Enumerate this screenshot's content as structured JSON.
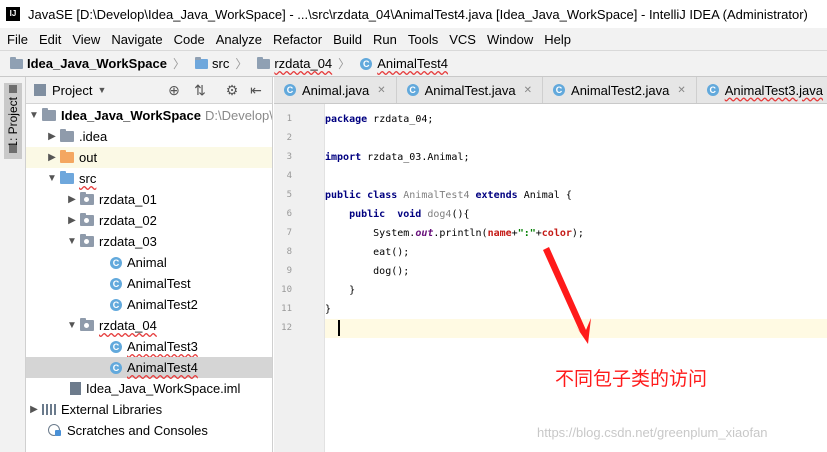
{
  "window": {
    "title": "JavaSE [D:\\Develop\\Idea_Java_WorkSpace] - ...\\src\\rzdata_04\\AnimalTest4.java [Idea_Java_WorkSpace] - IntelliJ IDEA (Administrator)",
    "app_icon_text": "IJ"
  },
  "menu": [
    "File",
    "Edit",
    "View",
    "Navigate",
    "Code",
    "Analyze",
    "Refactor",
    "Build",
    "Run",
    "Tools",
    "VCS",
    "Window",
    "Help"
  ],
  "breadcrumb": {
    "project": "Idea_Java_WorkSpace",
    "src": "src",
    "package": "rzdata_04",
    "file": "AnimalTest4"
  },
  "tool_strip": {
    "project_tab": "1: Project"
  },
  "project_panel": {
    "header_label": "Project",
    "tree": [
      {
        "label": "Idea_Java_WorkSpace",
        "hint": "D:\\Develop\\"
      },
      {
        "label": ".idea"
      },
      {
        "label": "out"
      },
      {
        "label": "src"
      },
      {
        "label": "rzdata_01"
      },
      {
        "label": "rzdata_02"
      },
      {
        "label": "rzdata_03"
      },
      {
        "label": "Animal"
      },
      {
        "label": "AnimalTest"
      },
      {
        "label": "AnimalTest2"
      },
      {
        "label": "rzdata_04"
      },
      {
        "label": "AnimalTest3"
      },
      {
        "label": "AnimalTest4"
      },
      {
        "label": "Idea_Java_WorkSpace.iml"
      },
      {
        "label": "External Libraries"
      },
      {
        "label": "Scratches and Consoles"
      }
    ]
  },
  "editor_tabs": [
    "Animal.java",
    "AnimalTest.java",
    "AnimalTest2.java",
    "AnimalTest3.java"
  ],
  "code": {
    "line_numbers": [
      "1",
      "2",
      "3",
      "4",
      "5",
      "6",
      "7",
      "8",
      "9",
      "10",
      "11",
      "12"
    ],
    "l1_kw": "package",
    "l1_rest": " rzdata_04;",
    "l3_kw": "import",
    "l3_rest": " rzdata_03.Animal;",
    "l5_kw1": "public class",
    "l5_cls": " AnimalTest4",
    "l5_kw2": " extends",
    "l5_rest": " Animal {",
    "l6_kw": "    public  void",
    "l6_name": " dog4",
    "l6_rest": "(){",
    "l7_a": "        System.",
    "l7_out": "out",
    "l7_b": ".println(",
    "l7_name": "name",
    "l7_plus1": "+",
    "l7_str": "\":\"",
    "l7_plus2": "+",
    "l7_color": "color",
    "l7_end": ");",
    "l8": "        eat();",
    "l9": "        dog();",
    "l10": "    }",
    "l11": "}"
  },
  "annotation": {
    "text": "不同包子类的访问",
    "color": "#ff1a1a"
  },
  "watermark": "https://blog.csdn.net/greenplum_xiaofan"
}
